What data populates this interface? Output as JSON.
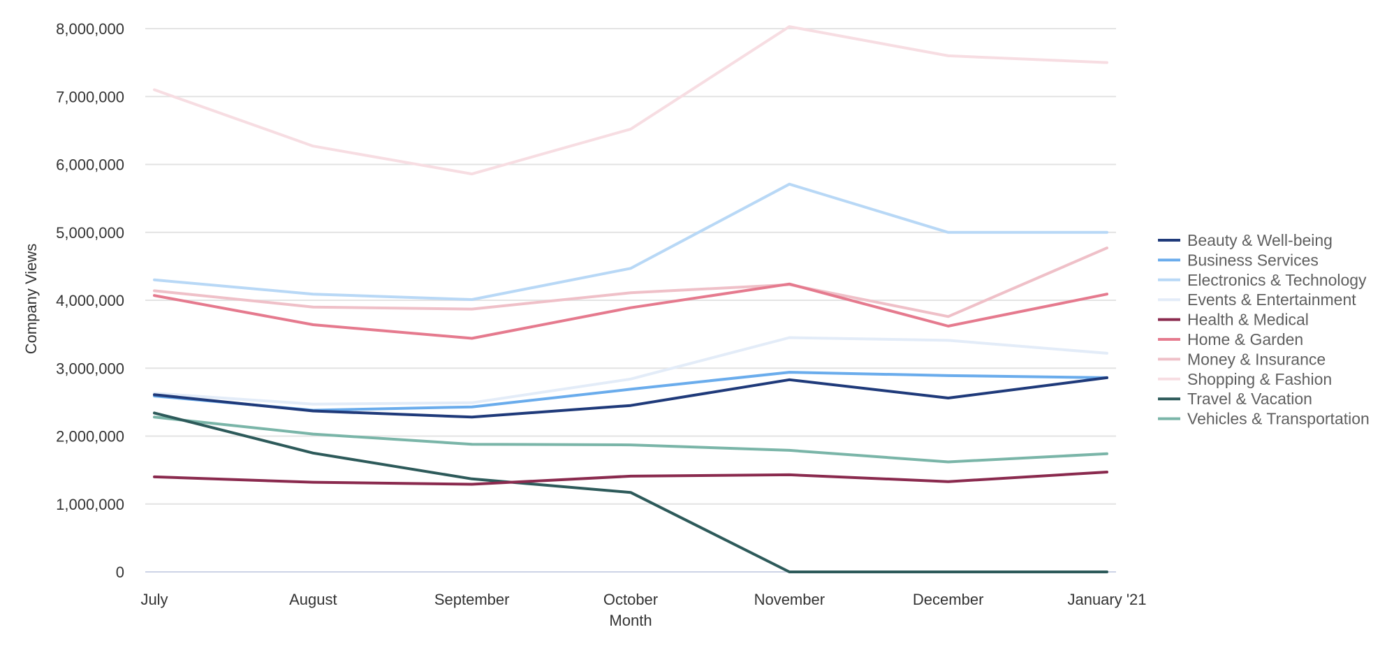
{
  "chart_data": {
    "type": "line",
    "title": "",
    "xlabel": "Month",
    "ylabel": "Company Views",
    "ylim": [
      0,
      8000000
    ],
    "yticks": [
      0,
      1000000,
      2000000,
      3000000,
      4000000,
      5000000,
      6000000,
      7000000,
      8000000
    ],
    "ytick_labels": [
      "0",
      "1,000,000",
      "2,000,000",
      "3,000,000",
      "4,000,000",
      "5,000,000",
      "6,000,000",
      "7,000,000",
      "8,000,000"
    ],
    "grid": true,
    "legend_position": "right",
    "categories": [
      "July",
      "August",
      "September",
      "October",
      "November",
      "December",
      "January '21"
    ],
    "series": [
      {
        "name": "Beauty & Well-being",
        "color": "#1f3a7a",
        "values": [
          2610000,
          2370000,
          2280000,
          2450000,
          2830000,
          2560000,
          2860000
        ]
      },
      {
        "name": "Business Services",
        "color": "#6aacec",
        "values": [
          2590000,
          2380000,
          2430000,
          2690000,
          2940000,
          2890000,
          2860000
        ]
      },
      {
        "name": "Electronics & Technology",
        "color": "#b8d8f6",
        "values": [
          4300000,
          4090000,
          4010000,
          4470000,
          5710000,
          5000000,
          5000000
        ]
      },
      {
        "name": "Events & Entertainment",
        "color": "#e3ecf8",
        "values": [
          2630000,
          2470000,
          2490000,
          2840000,
          3450000,
          3410000,
          3220000
        ]
      },
      {
        "name": "Health & Medical",
        "color": "#8a2a4e",
        "values": [
          1400000,
          1320000,
          1290000,
          1410000,
          1430000,
          1330000,
          1470000
        ]
      },
      {
        "name": "Home & Garden",
        "color": "#e57a8e",
        "values": [
          4070000,
          3640000,
          3440000,
          3890000,
          4240000,
          3620000,
          4090000
        ]
      },
      {
        "name": "Money & Insurance",
        "color": "#efc0c8",
        "values": [
          4140000,
          3900000,
          3870000,
          4110000,
          4230000,
          3760000,
          4770000
        ]
      },
      {
        "name": "Shopping & Fashion",
        "color": "#f7dde2",
        "values": [
          7100000,
          6270000,
          5860000,
          6520000,
          8030000,
          7600000,
          7500000
        ]
      },
      {
        "name": "Travel & Vacation",
        "color": "#2d5a5a",
        "values": [
          2340000,
          1750000,
          1370000,
          1170000,
          0,
          0,
          0
        ]
      },
      {
        "name": "Vehicles & Transportation",
        "color": "#7ab5a8",
        "values": [
          2280000,
          2030000,
          1880000,
          1870000,
          1790000,
          1620000,
          1740000
        ]
      }
    ]
  }
}
